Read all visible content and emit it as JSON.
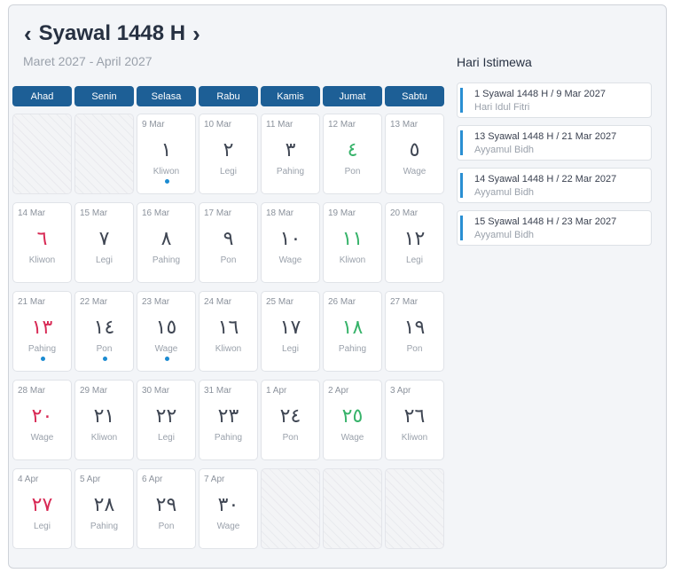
{
  "header": {
    "title": "Syawal 1448 H",
    "subtitle": "Maret 2027 - April 2027",
    "prev_icon": "chevron-left-icon",
    "next_icon": "chevron-right-icon"
  },
  "weekdays": [
    "Ahad",
    "Senin",
    "Selasa",
    "Rabu",
    "Kamis",
    "Jumat",
    "Sabtu"
  ],
  "weeks": [
    [
      {
        "empty": true
      },
      {
        "empty": true
      },
      {
        "g": "9 Mar",
        "h": "١",
        "p": "Kliwon",
        "dot": true,
        "color": "normal"
      },
      {
        "g": "10 Mar",
        "h": "٢",
        "p": "Legi",
        "color": "normal"
      },
      {
        "g": "11 Mar",
        "h": "٣",
        "p": "Pahing",
        "color": "normal"
      },
      {
        "g": "12 Mar",
        "h": "٤",
        "p": "Pon",
        "color": "green"
      },
      {
        "g": "13 Mar",
        "h": "٥",
        "p": "Wage",
        "color": "normal"
      }
    ],
    [
      {
        "g": "14 Mar",
        "h": "٦",
        "p": "Kliwon",
        "color": "red"
      },
      {
        "g": "15 Mar",
        "h": "٧",
        "p": "Legi",
        "color": "normal"
      },
      {
        "g": "16 Mar",
        "h": "٨",
        "p": "Pahing",
        "color": "normal"
      },
      {
        "g": "17 Mar",
        "h": "٩",
        "p": "Pon",
        "color": "normal"
      },
      {
        "g": "18 Mar",
        "h": "١٠",
        "p": "Wage",
        "color": "normal"
      },
      {
        "g": "19 Mar",
        "h": "١١",
        "p": "Kliwon",
        "color": "green"
      },
      {
        "g": "20 Mar",
        "h": "١٢",
        "p": "Legi",
        "color": "normal"
      }
    ],
    [
      {
        "g": "21 Mar",
        "h": "١٣",
        "p": "Pahing",
        "dot": true,
        "color": "red"
      },
      {
        "g": "22 Mar",
        "h": "١٤",
        "p": "Pon",
        "dot": true,
        "color": "normal"
      },
      {
        "g": "23 Mar",
        "h": "١٥",
        "p": "Wage",
        "dot": true,
        "color": "normal"
      },
      {
        "g": "24 Mar",
        "h": "١٦",
        "p": "Kliwon",
        "color": "normal"
      },
      {
        "g": "25 Mar",
        "h": "١٧",
        "p": "Legi",
        "color": "normal"
      },
      {
        "g": "26 Mar",
        "h": "١٨",
        "p": "Pahing",
        "color": "green"
      },
      {
        "g": "27 Mar",
        "h": "١٩",
        "p": "Pon",
        "color": "normal"
      }
    ],
    [
      {
        "g": "28 Mar",
        "h": "٢٠",
        "p": "Wage",
        "color": "red"
      },
      {
        "g": "29 Mar",
        "h": "٢١",
        "p": "Kliwon",
        "color": "normal"
      },
      {
        "g": "30 Mar",
        "h": "٢٢",
        "p": "Legi",
        "color": "normal"
      },
      {
        "g": "31 Mar",
        "h": "٢٣",
        "p": "Pahing",
        "color": "normal"
      },
      {
        "g": "1 Apr",
        "h": "٢٤",
        "p": "Pon",
        "color": "normal"
      },
      {
        "g": "2 Apr",
        "h": "٢٥",
        "p": "Wage",
        "color": "green"
      },
      {
        "g": "3 Apr",
        "h": "٢٦",
        "p": "Kliwon",
        "color": "normal"
      }
    ],
    [
      {
        "g": "4 Apr",
        "h": "٢٧",
        "p": "Legi",
        "color": "red"
      },
      {
        "g": "5 Apr",
        "h": "٢٨",
        "p": "Pahing",
        "color": "normal"
      },
      {
        "g": "6 Apr",
        "h": "٢٩",
        "p": "Pon",
        "color": "normal"
      },
      {
        "g": "7 Apr",
        "h": "٣٠",
        "p": "Wage",
        "color": "normal"
      },
      {
        "empty": true
      },
      {
        "empty": true
      },
      {
        "empty": true
      }
    ]
  ],
  "sidebar": {
    "title": "Hari Istimewa",
    "events": [
      {
        "title": "1 Syawal 1448 H / 9 Mar 2027",
        "subtitle": "Hari Idul Fitri"
      },
      {
        "title": "13 Syawal 1448 H / 21 Mar 2027",
        "subtitle": "Ayyamul Bidh"
      },
      {
        "title": "14 Syawal 1448 H / 22 Mar 2027",
        "subtitle": "Ayyamul Bidh"
      },
      {
        "title": "15 Syawal 1448 H / 23 Mar 2027",
        "subtitle": "Ayyamul Bidh"
      }
    ]
  },
  "colors": {
    "header_bg": "#1d5f96",
    "sunday_red": "#d82a55",
    "friday_green": "#37b36a",
    "event_dot": "#1b8bd1",
    "event_bar": "#2a8fd3"
  }
}
